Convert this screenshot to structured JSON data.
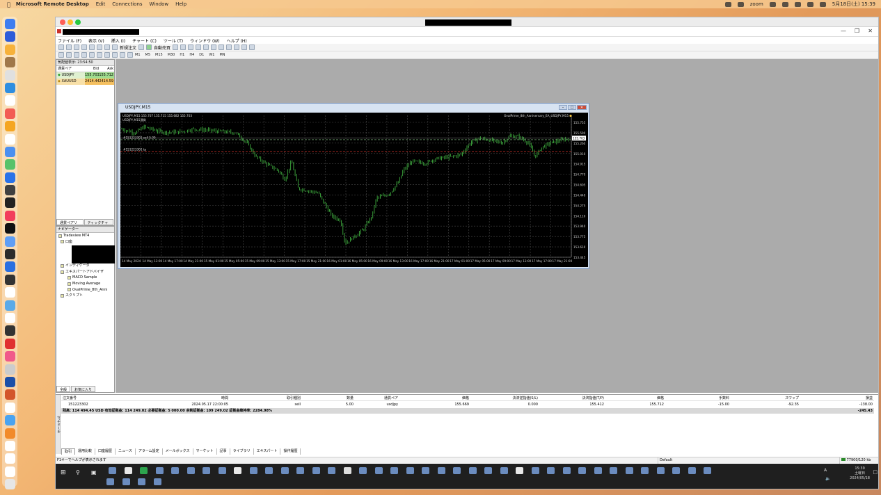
{
  "mac_menubar": {
    "app": "Microsoft Remote Desktop",
    "menus": [
      "Edit",
      "Connections",
      "Window",
      "Help"
    ],
    "zoom": "zoom",
    "datetime": "5月18日(土) 15:39"
  },
  "mt4": {
    "menu": [
      "ファイル (F)",
      "表示 (V)",
      "挿入 (I)",
      "チャート (C)",
      "ツール (T)",
      "ウィンドウ (W)",
      "ヘルプ (H)"
    ],
    "toolbar": {
      "new_order": "新規注文",
      "auto_trade": "自動売買"
    },
    "timeframes": [
      "M1",
      "M5",
      "M15",
      "M30",
      "H1",
      "H4",
      "D1",
      "W1",
      "MN"
    ],
    "market_watch": {
      "header": "気配値表示: 23:54:50",
      "columns": [
        "通貨ペア",
        "Bid",
        "Ask"
      ],
      "rows": [
        {
          "symbol": "USDJPY",
          "bid": "155.703",
          "ask": "155.712"
        },
        {
          "symbol": "XAUUSD",
          "bid": "2414.44",
          "ask": "2414.59"
        }
      ],
      "tabs": [
        "通貨ペアリスト",
        "ティックチャート"
      ]
    },
    "navigator": {
      "header": "ナビゲーター",
      "root": "Tradeview MT4",
      "accounts": "口座",
      "indicators": "インディケータ",
      "experts": "エキスパートアドバイザ",
      "ea_items": [
        "MACD Sample",
        "Moving Average",
        "OvalPrime_8th_Anni"
      ],
      "scripts": "スクリプト",
      "tabs": [
        "全般",
        "お気に入り"
      ]
    },
    "chart": {
      "window_title": "USDJPY,M15",
      "info_line": "USDJPY,M15  155.707 155.715 155.682 155.703",
      "sub_label": "USDJPY,M15通貨",
      "ea_label": "OvalPrime_8th_Anniversary_EA_USDJPY,M15",
      "order_line_1": "#151223302 sell 5.00",
      "order_line_2": "#151223302 tp",
      "current_price": "155.703"
    },
    "terminal": {
      "headers": [
        "注文番号",
        "時間",
        "取引種別",
        "数量",
        "通貨ペア",
        "価格",
        "決済逆指値(S/L)",
        "決済指値(T/P)",
        "価格",
        "手数料",
        "スワップ",
        "損益"
      ],
      "order": {
        "ticket": "151223302",
        "time": "2024.05.17 22:00:05",
        "type": "sell",
        "size": "5.00",
        "symbol": "usdjpy",
        "price": "155.669",
        "sl": "0.000",
        "tp": "155.412",
        "current": "155.712",
        "commission": "-15.00",
        "swap": "-92.35",
        "profit": "-138.00"
      },
      "summary": "残高: 114 494.45 USD  有効証拠金: 114 249.02  必要証拠金: 5 000.00  余剰証拠金: 109 249.02  証拠金維持率: 2284.98%",
      "summary_total": "-245.43",
      "side_label": "ターミナル",
      "tabs": [
        "取引",
        "運用比較",
        "口座履歴",
        "ニュース",
        "アラーム設定",
        "メールボックス",
        "マーケット",
        "記事",
        "ライブラリ",
        "エキスパート",
        "操作履歴"
      ]
    },
    "statusbar": {
      "help": "F1キーでヘルプが表示されます",
      "profile": "Default",
      "traffic": "77900/120 kb"
    }
  },
  "windows_taskbar": {
    "time": "15:39",
    "day": "土曜日",
    "date": "2024/05/18",
    "ime": "A"
  },
  "chart_data": {
    "type": "candlestick",
    "symbol": "USDJPY",
    "timeframe": "M15",
    "price_ticks": [
      "155.755",
      "155.590",
      "155.260",
      "155.010",
      "154.915",
      "154.770",
      "154.605",
      "154.440",
      "154.275",
      "154.110",
      "153.940",
      "153.775",
      "153.610",
      "153.445"
    ],
    "time_ticks": [
      "14 May 2024",
      "14 May 13:00",
      "14 May 17:00",
      "14 May 21:00",
      "15 May 01:00",
      "15 May 05:00",
      "15 May 09:00",
      "15 May 13:00",
      "15 May 17:00",
      "15 May 21:00",
      "16 May 01:00",
      "16 May 05:00",
      "16 May 09:00",
      "16 May 13:00",
      "16 May 17:00",
      "16 May 21:00",
      "17 May 01:00",
      "17 May 05:00",
      "17 May 09:00",
      "17 May 13:00",
      "17 May 17:00",
      "17 May 21:00"
    ],
    "ylim": [
      153.1,
      156.2
    ],
    "order_price": 155.669,
    "tp_price": 155.412,
    "close_path": [
      [
        0,
        155.9
      ],
      [
        0.03,
        155.82
      ],
      [
        0.05,
        155.95
      ],
      [
        0.08,
        155.86
      ],
      [
        0.1,
        155.83
      ],
      [
        0.13,
        155.84
      ],
      [
        0.16,
        155.9
      ],
      [
        0.19,
        155.88
      ],
      [
        0.22,
        155.85
      ],
      [
        0.255,
        155.82
      ],
      [
        0.28,
        155.6
      ],
      [
        0.3,
        155.3
      ],
      [
        0.33,
        155.1
      ],
      [
        0.35,
        155.0
      ],
      [
        0.365,
        154.8
      ],
      [
        0.38,
        155.2
      ],
      [
        0.395,
        154.6
      ],
      [
        0.42,
        154.55
      ],
      [
        0.44,
        154.5
      ],
      [
        0.47,
        154.0
      ],
      [
        0.49,
        153.9
      ],
      [
        0.5,
        153.4
      ],
      [
        0.52,
        153.55
      ],
      [
        0.54,
        153.7
      ],
      [
        0.56,
        154.0
      ],
      [
        0.57,
        154.4
      ],
      [
        0.59,
        154.45
      ],
      [
        0.6,
        154.5
      ],
      [
        0.62,
        154.75
      ],
      [
        0.63,
        155.0
      ],
      [
        0.65,
        155.2
      ],
      [
        0.68,
        155.15
      ],
      [
        0.7,
        155.25
      ],
      [
        0.74,
        155.3
      ],
      [
        0.76,
        155.35
      ],
      [
        0.78,
        155.6
      ],
      [
        0.8,
        155.7
      ],
      [
        0.83,
        155.65
      ],
      [
        0.85,
        155.6
      ],
      [
        0.87,
        155.75
      ],
      [
        0.89,
        155.73
      ],
      [
        0.91,
        155.6
      ],
      [
        0.925,
        155.3
      ],
      [
        0.94,
        155.5
      ],
      [
        0.96,
        155.6
      ],
      [
        1.0,
        155.7
      ]
    ]
  }
}
